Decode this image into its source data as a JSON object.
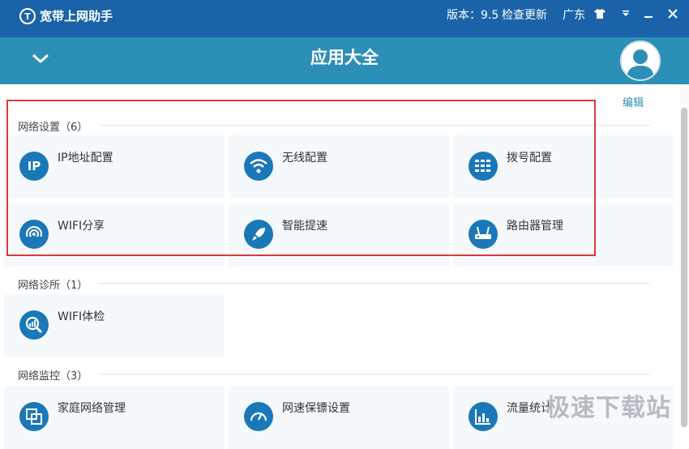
{
  "titlebar": {
    "app_title": "宽带上网助手",
    "version": "版本：9.5",
    "check_update": "检查更新",
    "region": "广东"
  },
  "header": {
    "title": "应用大全"
  },
  "edit_label": "编辑",
  "sections": [
    {
      "title": "网络设置（6）",
      "items": [
        {
          "label": "IP地址配置",
          "icon": "ip-icon"
        },
        {
          "label": "无线配置",
          "icon": "wifi-icon"
        },
        {
          "label": "拨号配置",
          "icon": "dial-icon"
        },
        {
          "label": "WIFI分享",
          "icon": "wifi-share-icon"
        },
        {
          "label": "智能提速",
          "icon": "rocket-icon"
        },
        {
          "label": "路由器管理",
          "icon": "router-icon"
        }
      ]
    },
    {
      "title": "网络诊所（1）",
      "items": [
        {
          "label": "WIFI体检",
          "icon": "wifi-check-icon"
        }
      ]
    },
    {
      "title": "网络监控（3）",
      "items": [
        {
          "label": "家庭网络管理",
          "icon": "home-network-icon"
        },
        {
          "label": "网速保镖设置",
          "icon": "speedometer-icon"
        },
        {
          "label": "流量统计",
          "icon": "traffic-stats-icon"
        }
      ]
    }
  ],
  "watermark": "极速下载站",
  "colors": {
    "titlebar": "#1b63a8",
    "header": "#2c8fb6",
    "icon_bg": "#1b78b8",
    "highlight": "#d63b3b"
  }
}
